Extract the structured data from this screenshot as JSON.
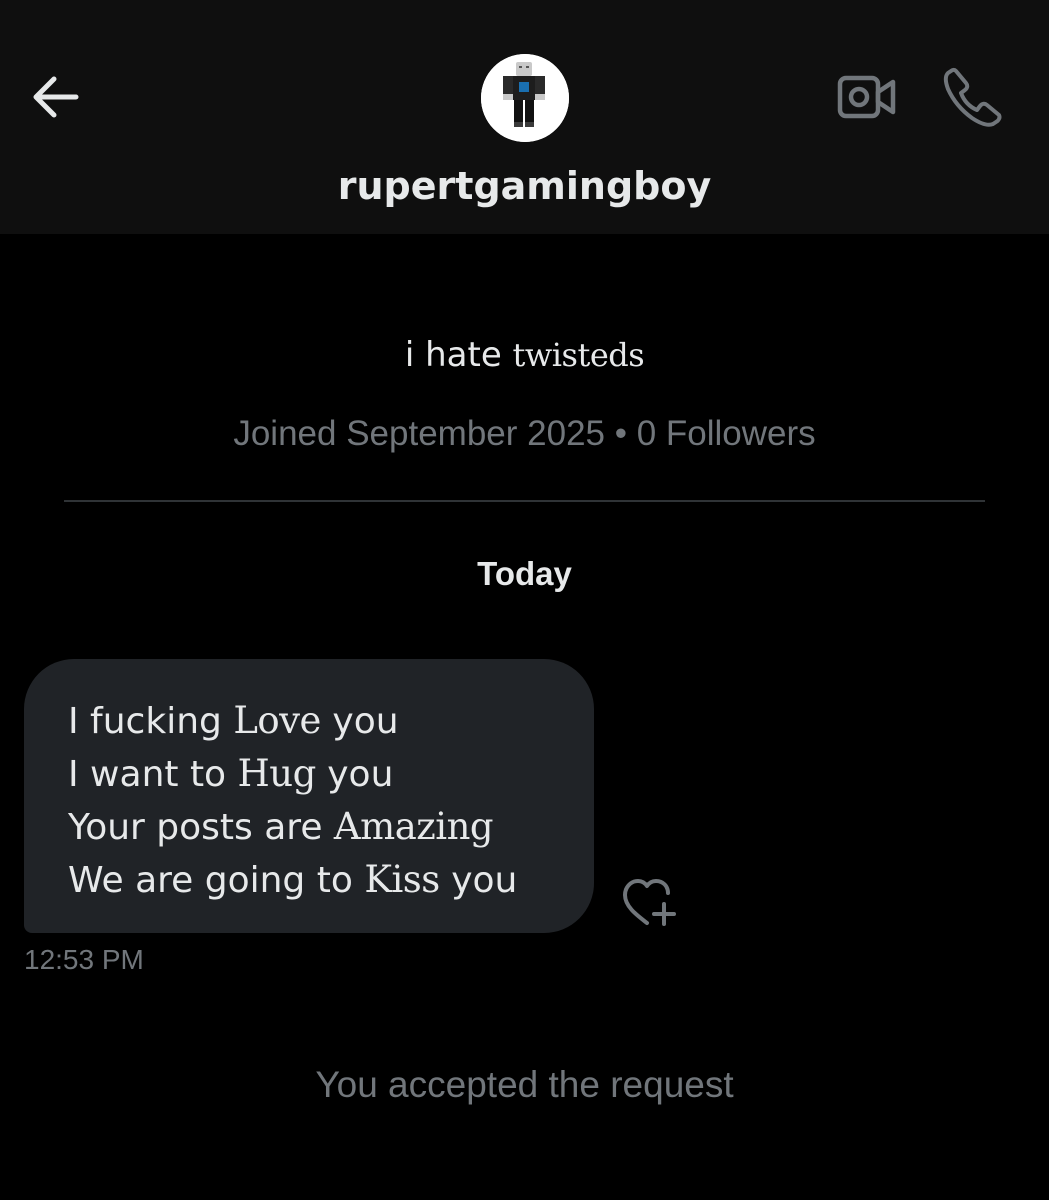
{
  "header": {
    "back_icon": "arrow-left-icon",
    "username": "rupertgamingboy",
    "avatar": "roblox-character-avatar",
    "video_icon": "video-camera-icon",
    "call_icon": "phone-icon"
  },
  "profile": {
    "bio_plain": "i hate ",
    "bio_fancy": "twisteds",
    "meta": "Joined September 2025 • 0 Followers"
  },
  "conversation": {
    "day_label": "Today",
    "messages": [
      {
        "lines": [
          {
            "plain": "I fucking ",
            "fancy": "Love",
            "after": " you"
          },
          {
            "plain": "I want to ",
            "fancy": "Hug",
            "after": " you"
          },
          {
            "plain": "Your posts are ",
            "fancy": "Amazing",
            "after": ""
          },
          {
            "plain": "We are going to ",
            "fancy": "Kiss",
            "after": " you"
          }
        ],
        "time": "12:53 PM",
        "react_icon": "heart-plus-icon"
      }
    ],
    "system_message": "You accepted the request"
  },
  "colors": {
    "background": "#000000",
    "header_bg": "#0f0f0f",
    "bubble_bg": "#202327",
    "primary_text": "#e7e9ea",
    "secondary_text": "#71767b",
    "divider": "#2f3336"
  }
}
